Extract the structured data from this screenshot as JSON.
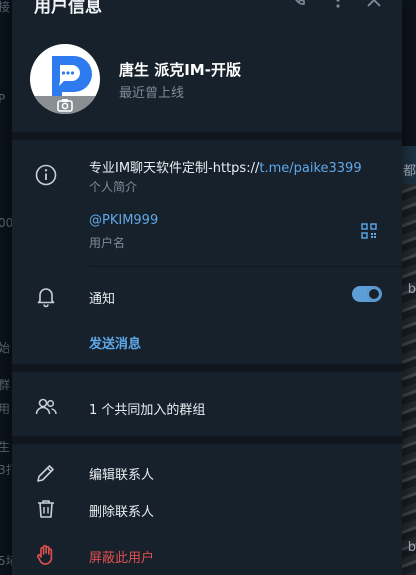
{
  "header": {
    "title": "用户信息"
  },
  "profile": {
    "name": "唐生 派克IM-开版",
    "status": "最近曾上线"
  },
  "info": {
    "bio_prefix": "专业IM聊天软件定制-https://",
    "bio_link": "t.me/paike3399",
    "bio_label": "个人简介",
    "username": "@PKIM999",
    "username_label": "用户名"
  },
  "notifications": {
    "label": "通知",
    "enabled": true
  },
  "actions": {
    "send_message": "发送消息",
    "common_groups": "1 个共同加入的群组",
    "edit_contact": "编辑联系人",
    "delete_contact": "删除联系人",
    "block_user": "屏蔽此用户"
  },
  "background": {
    "left_fragments": [
      "接",
      "P",
      "00",
      "始",
      "群",
      "用",
      "生",
      "3打",
      "5堵"
    ],
    "right_fragments": [
      "都",
      "b",
      "b"
    ]
  },
  "colors": {
    "accent": "#5fa8e8",
    "danger": "#e0504d",
    "panel": "#17212b"
  },
  "icons": {
    "camera": "camera-icon",
    "info": "info-icon",
    "qr": "qr-code-icon",
    "bell": "bell-icon",
    "group": "group-icon",
    "edit": "pencil-icon",
    "delete": "trash-icon",
    "block": "hand-icon"
  }
}
